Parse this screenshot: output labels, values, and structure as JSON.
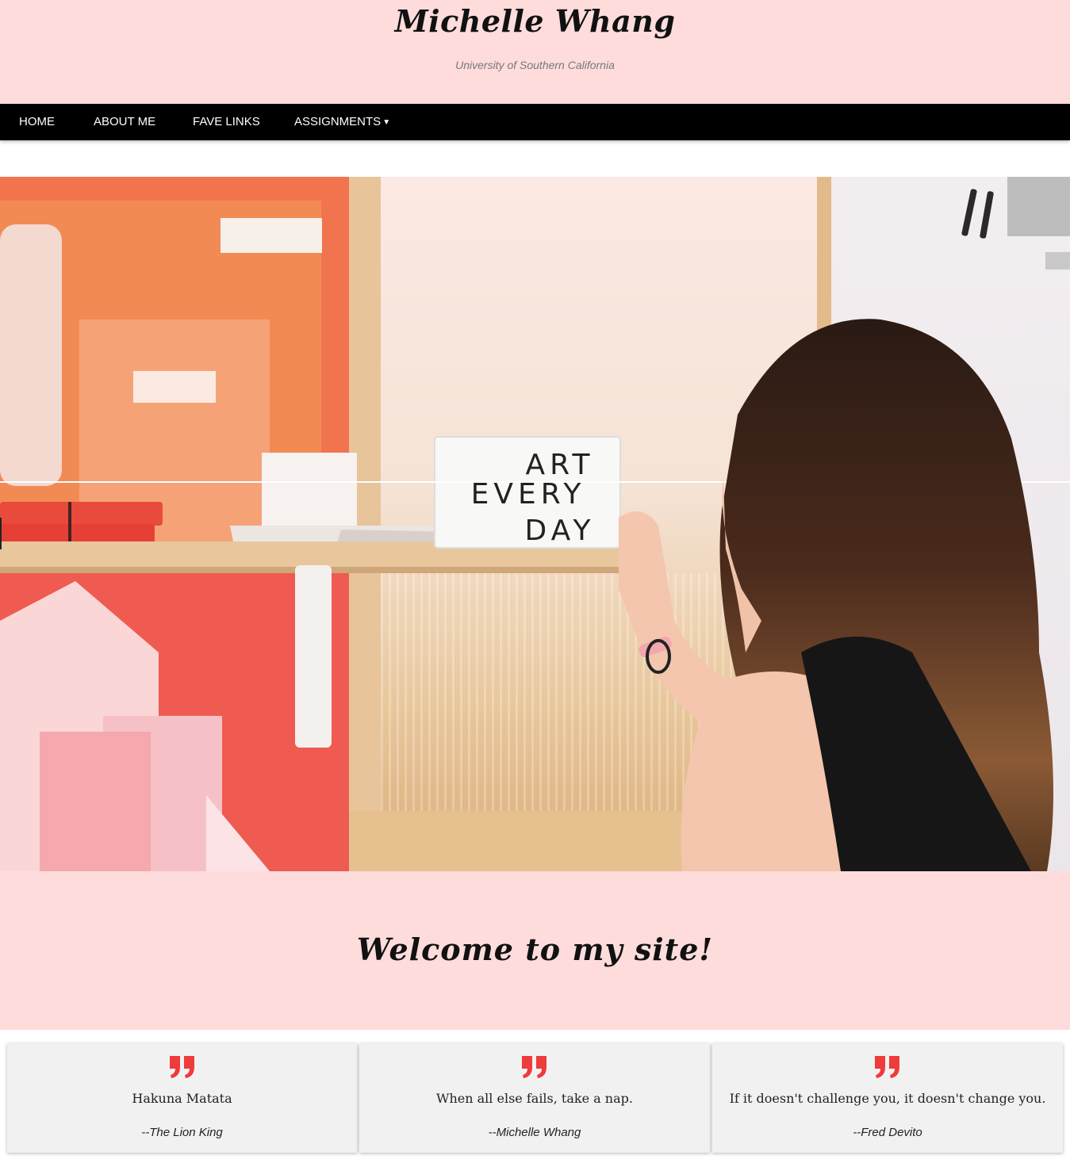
{
  "header": {
    "title": "Michelle Whang",
    "subtitle": "University of Southern California",
    "background": "#ffdcdc"
  },
  "nav": {
    "items": [
      {
        "label": "HOME"
      },
      {
        "label": "ABOUT ME"
      },
      {
        "label": "FAVE LINKS"
      },
      {
        "label": "ASSIGNMENTS",
        "has_dropdown": true
      }
    ],
    "caret_icon": "caret-down-icon"
  },
  "hero": {
    "sign_lines": [
      "ART",
      "EVERY",
      "DAY"
    ]
  },
  "welcome": {
    "title": "Welcome to my site!"
  },
  "quotes": [
    {
      "text": "Hakuna Matata",
      "author": "--The Lion King"
    },
    {
      "text": "When all else fails, take a nap.",
      "author": "--Michelle Whang"
    },
    {
      "text": "If it doesn't challenge you, it doesn't change you.",
      "author": "--Fred Devito"
    }
  ],
  "colors": {
    "accent_quote": "#ee3b3b",
    "nav_bg": "#000000",
    "card_bg": "#f1f1f1"
  }
}
